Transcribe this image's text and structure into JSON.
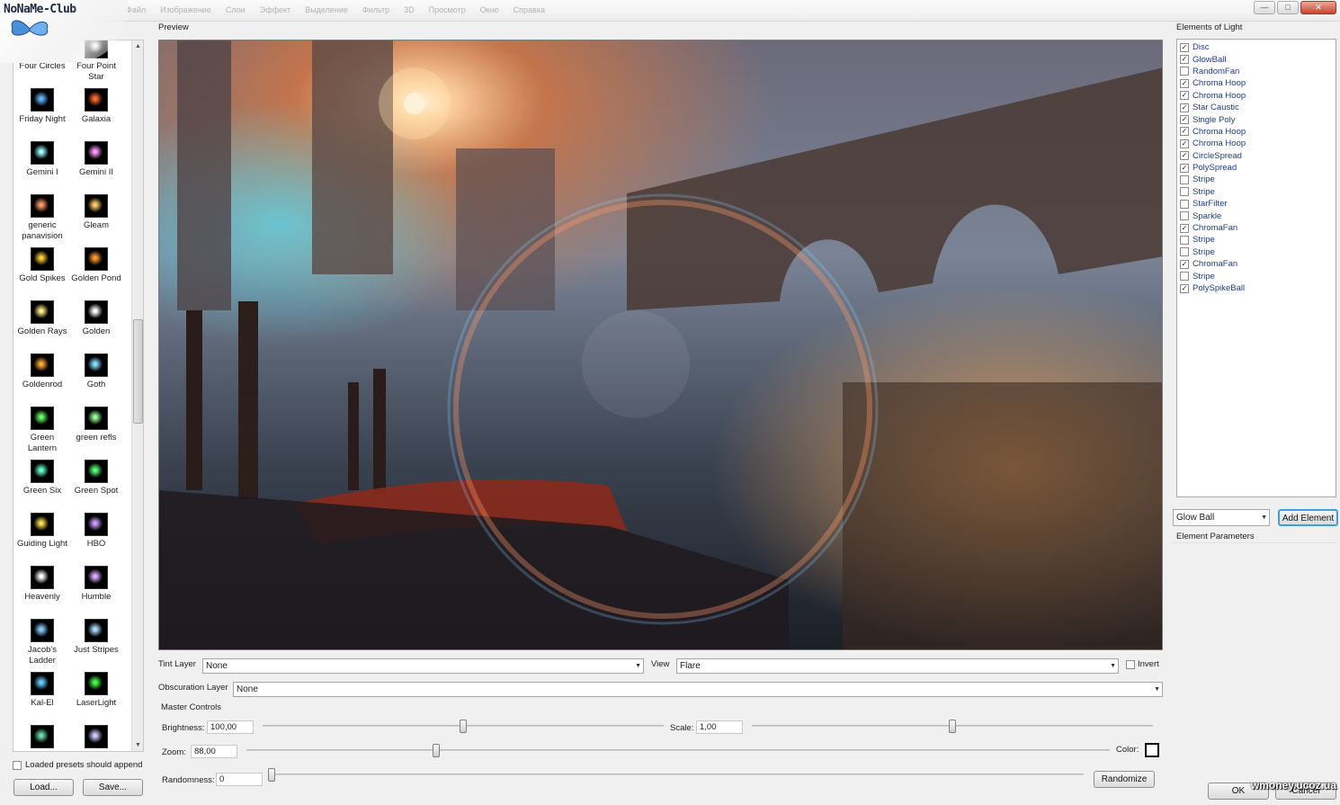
{
  "app": {
    "logo_text": "NoNaMe-Club",
    "menu_items": [
      "Файл",
      "Изображение",
      "Слои",
      "Эффект",
      "Выделение",
      "Фильтр",
      "3D",
      "Просмотр",
      "Окно",
      "Справка"
    ],
    "window_buttons": [
      "—",
      "□",
      "✕"
    ]
  },
  "presets": {
    "items": [
      {
        "label": "Four Circles",
        "glow": "#c9d6ff"
      },
      {
        "label": "Four Point Star",
        "glow": "#ffffff"
      },
      {
        "label": "Friday Night",
        "glow": "#66b3ff"
      },
      {
        "label": "Galaxia",
        "glow": "#ff6633"
      },
      {
        "label": "Gemini I",
        "glow": "#99ffff"
      },
      {
        "label": "Gemini II",
        "glow": "#ff99ff"
      },
      {
        "label": "generic panavision",
        "glow": "#ff9966"
      },
      {
        "label": "Gleam",
        "glow": "#ffcc66"
      },
      {
        "label": "Gold Spikes",
        "glow": "#ffcc33"
      },
      {
        "label": "Golden Pond",
        "glow": "#ff9933"
      },
      {
        "label": "Golden Rays",
        "glow": "#ffee88"
      },
      {
        "label": "Golden",
        "glow": "#ffffff"
      },
      {
        "label": "Goldenrod",
        "glow": "#ffaa33"
      },
      {
        "label": "Goth",
        "glow": "#88ddff"
      },
      {
        "label": "Green Lantern",
        "glow": "#66ff66"
      },
      {
        "label": "green refls",
        "glow": "#99ff99"
      },
      {
        "label": "Green Six",
        "glow": "#66ffcc"
      },
      {
        "label": "Green Spot",
        "glow": "#55ff77"
      },
      {
        "label": "Guiding Light",
        "glow": "#ffdd55"
      },
      {
        "label": "HBO",
        "glow": "#cc99ff"
      },
      {
        "label": "Heavenly",
        "glow": "#ffffff"
      },
      {
        "label": "Humble",
        "glow": "#ddaaff"
      },
      {
        "label": "Jacob's Ladder",
        "glow": "#88ccff"
      },
      {
        "label": "Just Stripes",
        "glow": "#aaddff"
      },
      {
        "label": "Kal-El",
        "glow": "#66ccff"
      },
      {
        "label": "LaserLight",
        "glow": "#44ff44"
      },
      {
        "label": "",
        "glow": "#66ddaa"
      },
      {
        "label": "",
        "glow": "#ccccff"
      }
    ],
    "append_label": "Loaded presets should append",
    "append_checked": false,
    "load_button": "Load...",
    "save_button": "Save..."
  },
  "preview": {
    "label": "Preview"
  },
  "controls": {
    "tint_layer_label": "Tint Layer",
    "tint_layer_value": "None",
    "view_label": "View",
    "view_value": "Flare",
    "invert_label": "Invert",
    "invert_checked": false,
    "obscuration_label": "Obscuration Layer",
    "obscuration_value": "None",
    "master_controls_label": "Master Controls",
    "brightness_label": "Brightness:",
    "brightness_value": "100,00",
    "scale_label": "Scale:",
    "scale_value": "1,00",
    "zoom_label": "Zoom:",
    "zoom_value": "88,00",
    "color_label": "Color:",
    "color_value": "#000000",
    "randomness_label": "Randomness:",
    "randomness_value": "0",
    "randomize_button": "Randomize",
    "slider_levels": {
      "brightness": 0.5,
      "scale": 0.5,
      "zoom": 0.22,
      "randomness": 0.0
    }
  },
  "elements": {
    "title": "Elements of Light",
    "items": [
      {
        "label": "Disc",
        "checked": true
      },
      {
        "label": "GlowBall",
        "checked": true
      },
      {
        "label": "RandomFan",
        "checked": false
      },
      {
        "label": "Chroma Hoop",
        "checked": true
      },
      {
        "label": "Chroma Hoop",
        "checked": true
      },
      {
        "label": "Star Caustic",
        "checked": true
      },
      {
        "label": "Single Poly",
        "checked": true
      },
      {
        "label": "Chroma Hoop",
        "checked": true
      },
      {
        "label": "Chroma Hoop",
        "checked": true
      },
      {
        "label": "CircleSpread",
        "checked": true
      },
      {
        "label": "PolySpread",
        "checked": true
      },
      {
        "label": "Stripe",
        "checked": false
      },
      {
        "label": "Stripe",
        "checked": false
      },
      {
        "label": "StarFilter",
        "checked": false
      },
      {
        "label": "Sparkle",
        "checked": false
      },
      {
        "label": "ChromaFan",
        "checked": true
      },
      {
        "label": "Stripe",
        "checked": false
      },
      {
        "label": "Stripe",
        "checked": false
      },
      {
        "label": "ChromaFan",
        "checked": true
      },
      {
        "label": "Stripe",
        "checked": false
      },
      {
        "label": "PolySpikeBall",
        "checked": true
      }
    ],
    "type_select_value": "Glow Ball",
    "add_button": "Add Element",
    "parameters_label": "Element Parameters",
    "ok_button": "OK",
    "cancel_button": "Cancel"
  },
  "watermark": "wmoney.ucoz.ua"
}
